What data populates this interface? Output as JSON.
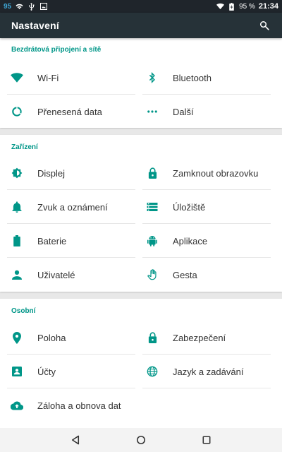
{
  "status_bar": {
    "notification_count": "95",
    "battery_percent": "95 %",
    "time": "21:34",
    "icons": [
      "wifi-icon",
      "usb-icon",
      "image-icon",
      "wifi-signal-icon",
      "battery-icon"
    ]
  },
  "toolbar": {
    "title": "Nastavení",
    "search_icon": "search-icon"
  },
  "colors": {
    "accent": "#009688",
    "toolbar": "#263238",
    "statusbar": "#1f252b",
    "background": "#e8e8e8"
  },
  "sections": {
    "wireless": {
      "header": "Bezdrátová připojení a sítě",
      "items": [
        {
          "label": "Wi-Fi",
          "icon": "wifi-icon"
        },
        {
          "label": "Bluetooth",
          "icon": "bluetooth-icon"
        },
        {
          "label": "Přenesená data",
          "icon": "data-usage-icon"
        },
        {
          "label": "Další",
          "icon": "more-icon"
        }
      ]
    },
    "device": {
      "header": "Zařízení",
      "items": [
        {
          "label": "Displej",
          "icon": "brightness-icon"
        },
        {
          "label": "Zamknout obrazovku",
          "icon": "lock-icon"
        },
        {
          "label": "Zvuk a oznámení",
          "icon": "bell-icon"
        },
        {
          "label": "Úložiště",
          "icon": "storage-icon"
        },
        {
          "label": "Baterie",
          "icon": "battery-icon"
        },
        {
          "label": "Aplikace",
          "icon": "android-icon"
        },
        {
          "label": "Uživatelé",
          "icon": "person-icon"
        },
        {
          "label": "Gesta",
          "icon": "hand-icon"
        }
      ]
    },
    "personal": {
      "header": "Osobní",
      "items": [
        {
          "label": "Poloha",
          "icon": "location-icon"
        },
        {
          "label": "Zabezpečení",
          "icon": "lock-icon"
        },
        {
          "label": "Účty",
          "icon": "account-box-icon"
        },
        {
          "label": "Jazyk a zadávání",
          "icon": "globe-icon"
        },
        {
          "label": "Záloha a obnova dat",
          "icon": "cloud-upload-icon"
        }
      ]
    }
  },
  "nav_bar": {
    "icons": [
      "back-icon",
      "home-icon",
      "recents-icon"
    ]
  }
}
